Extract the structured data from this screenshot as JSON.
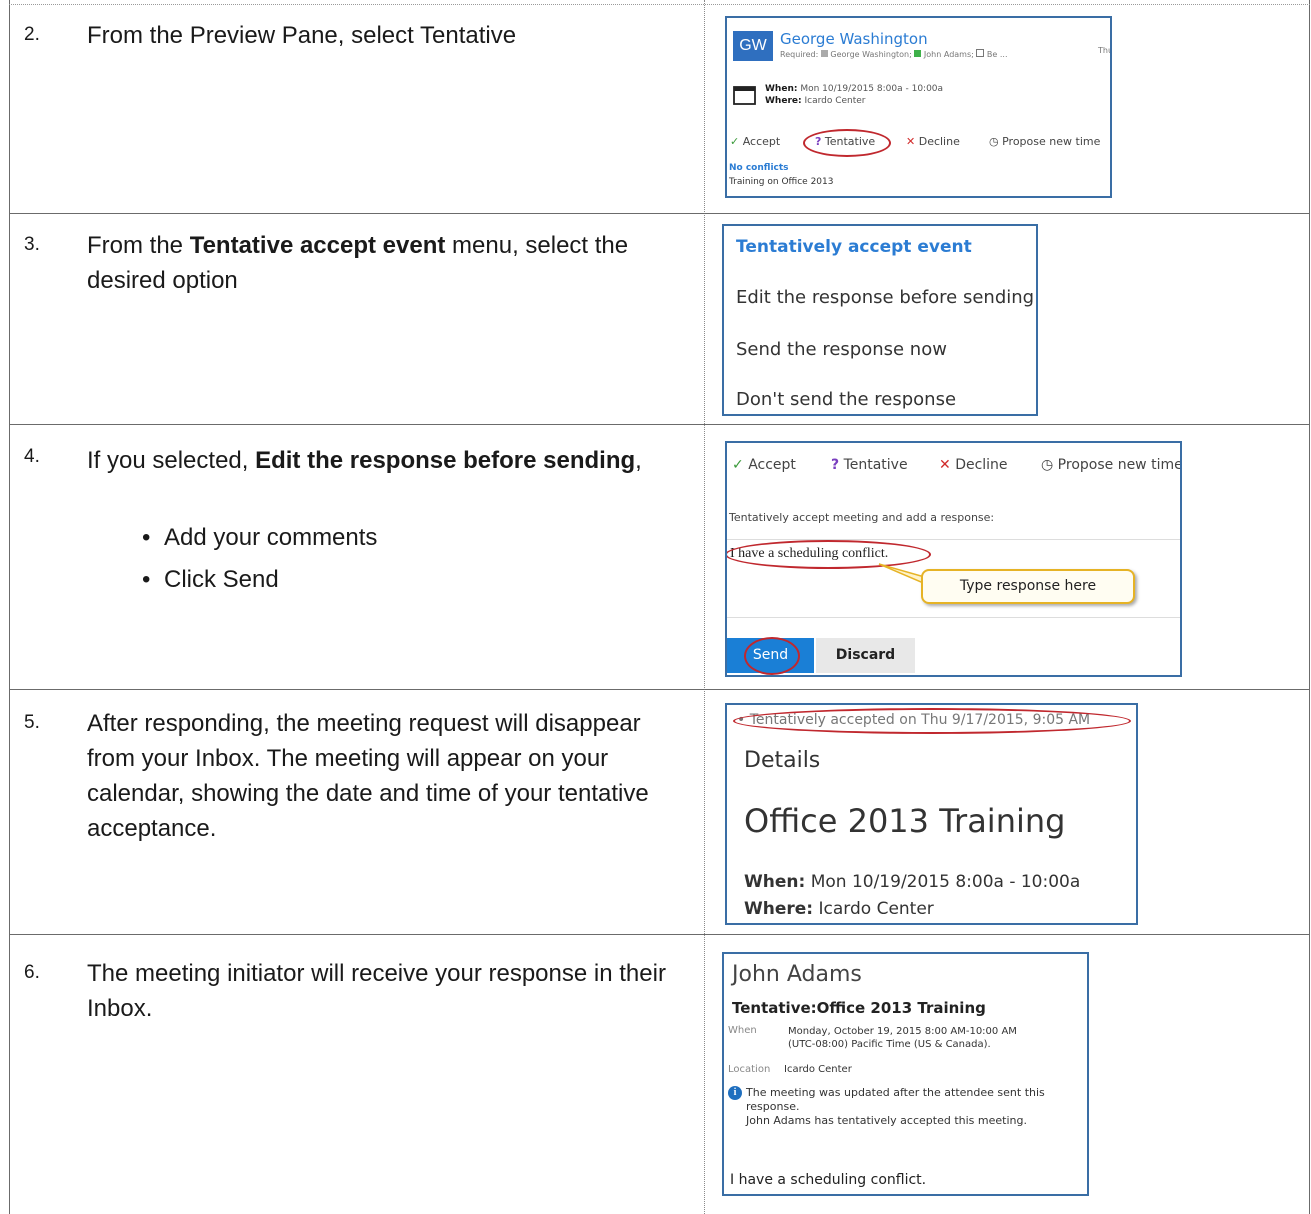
{
  "steps": [
    {
      "num": "2.",
      "text": "From the Preview Pane, select Tentative"
    },
    {
      "num": "3.",
      "pre": "From the ",
      "bold": "Tentative accept event",
      "post": " menu, select the desired option"
    },
    {
      "num": "4.",
      "pre": "If you selected, ",
      "bold": "Edit the response before sending",
      "post": ",",
      "bullets": [
        "Add your comments",
        "Click Send"
      ]
    },
    {
      "num": "5.",
      "text": "After responding, the meeting request will disappear from your Inbox. The meeting will appear on your calendar, showing the date and time of your tentative acceptance."
    },
    {
      "num": "6.",
      "text": "The meeting initiator will receive your response in their Inbox."
    }
  ],
  "preview": {
    "initials": "GW",
    "name": "George Washington",
    "required_label": "Required:",
    "attendees": "George Washington; ",
    "attendee2": "John Adams; ",
    "attendee3": "Be ...",
    "right_cut": "Thu",
    "when_label": "When:",
    "when": "Mon 10/19/2015 8:00a - 10:00a",
    "where_label": "Where:",
    "where": "Icardo Center",
    "accept": "Accept",
    "tentative": "Tentative",
    "decline": "Decline",
    "propose": "Propose new time",
    "conflicts": "No conflicts",
    "subject": "Training on Office 2013"
  },
  "menu": {
    "title": "Tentatively accept event",
    "items": [
      "Edit the response before sending",
      "Send the response now",
      "Don't send the response"
    ]
  },
  "response": {
    "accept": "Accept",
    "tentative": "Tentative",
    "decline": "Decline",
    "propose": "Propose new time",
    "prompt": "Tentatively accept meeting and add a response:",
    "message": "I have a scheduling conflict.",
    "callout": "Type response here",
    "send": "Send",
    "discard": "Discard"
  },
  "calendar": {
    "status": "Tentatively accepted on Thu 9/17/2015, 9:05 AM",
    "details": "Details",
    "title": "Office 2013 Training",
    "when_label": "When:",
    "when": "Mon 10/19/2015 8:00a - 10:00a",
    "where_label": "Where:",
    "where": "Icardo Center"
  },
  "inbox": {
    "sender": "John Adams",
    "subject": "Tentative:Office 2013 Training",
    "when_label": "When",
    "when_line1": "Monday, October 19, 2015 8:00 AM-10:00 AM",
    "when_line2": "(UTC-08:00) Pacific Time (US & Canada).",
    "location_label": "Location",
    "location": "Icardo Center",
    "info_line1": "The meeting was updated after the attendee sent this",
    "info_line2": "response.",
    "info_line3": "John Adams has tentatively accepted this meeting.",
    "message": "I have a scheduling conflict."
  },
  "colors": {
    "accent": "#2b7cd3",
    "oval": "#c0282e",
    "accept": "#3a9a3a",
    "tentative": "#7a3fbf",
    "decline": "#d12b2b"
  }
}
